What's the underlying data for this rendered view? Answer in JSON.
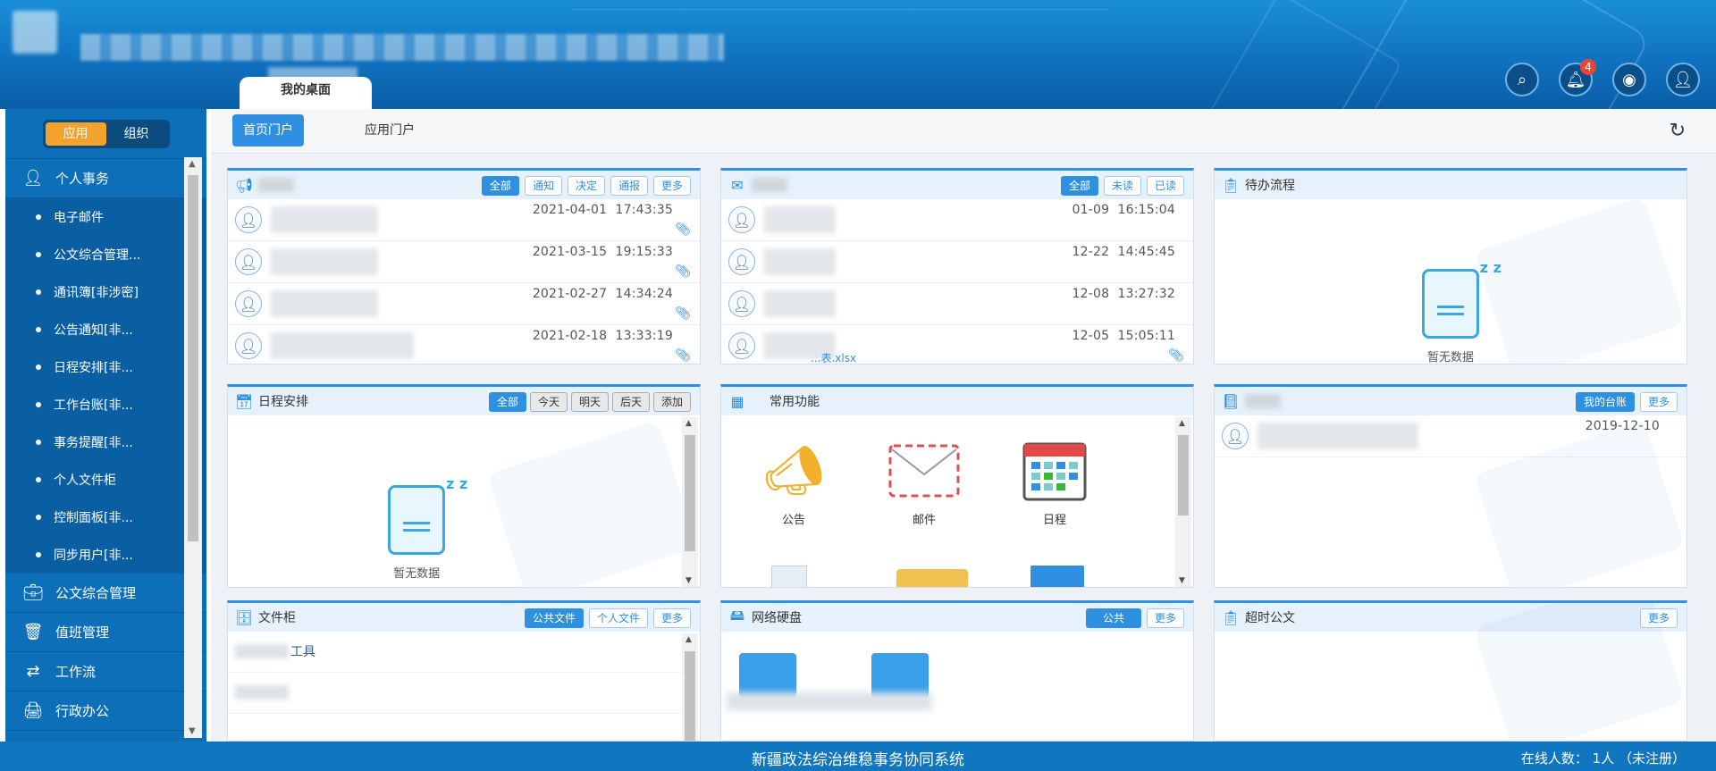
{
  "header": {
    "desk_tab": "我的桌面",
    "notification_count": "4"
  },
  "sidebar": {
    "switch": [
      "应用",
      "组织"
    ],
    "groups": [
      {
        "label": "个人事务"
      },
      {
        "label": "公文综合管理"
      },
      {
        "label": "值班管理"
      },
      {
        "label": "工作流"
      },
      {
        "label": "行政办公"
      }
    ],
    "items": [
      "电子邮件",
      "公文综合管理...",
      "通讯簿[非涉密]",
      "公告通知[非...",
      "日程安排[非...",
      "工作台账[非...",
      "事务提醒[非...",
      "个人文件柜",
      "控制面板[非...",
      "同步用户[非..."
    ]
  },
  "topbar": {
    "tabs": [
      "首页门户",
      "应用门户"
    ]
  },
  "panels": {
    "notices": {
      "buttons": [
        "全部",
        "通知",
        "决定",
        "通报",
        "更多"
      ],
      "rows": [
        {
          "date": "2021-04-01",
          "time": "17:43:35"
        },
        {
          "date": "2021-03-15",
          "time": "19:15:33"
        },
        {
          "date": "2021-02-27",
          "time": "14:34:24"
        },
        {
          "date": "2021-02-18",
          "time": "13:33:19"
        }
      ]
    },
    "mail": {
      "buttons": [
        "全部",
        "未读",
        "已读"
      ],
      "rows": [
        {
          "date": "01-09",
          "time": "16:15:04"
        },
        {
          "date": "12-22",
          "time": "14:45:45"
        },
        {
          "date": "12-08",
          "time": "13:27:32"
        },
        {
          "date": "12-05",
          "time": "15:05:11",
          "file": "...表.xlsx"
        }
      ]
    },
    "pending": {
      "title": "待办流程",
      "empty": "暂无数据"
    },
    "schedule": {
      "title": "日程安排",
      "buttons": [
        "全部",
        "今天",
        "明天",
        "后天",
        "添加"
      ],
      "empty": "暂无数据"
    },
    "functions": {
      "title": "常用功能",
      "items": [
        "公告",
        "邮件",
        "日程"
      ]
    },
    "ledger": {
      "buttons": [
        "我的台账",
        "更多"
      ],
      "date": "2019-12-10"
    },
    "filecab": {
      "title": "文件柜",
      "buttons": [
        "公共文件",
        "个人文件",
        "更多"
      ],
      "row1": "工具"
    },
    "netdisk": {
      "title": "网络硬盘",
      "buttons": [
        "公共",
        "更多"
      ]
    },
    "overdue": {
      "title": "超时公文",
      "buttons": [
        "更多"
      ]
    }
  },
  "footer": {
    "system_name": "新疆政法综治维稳事务协同系统",
    "online": "在线人数： 1人 （未注册）"
  }
}
